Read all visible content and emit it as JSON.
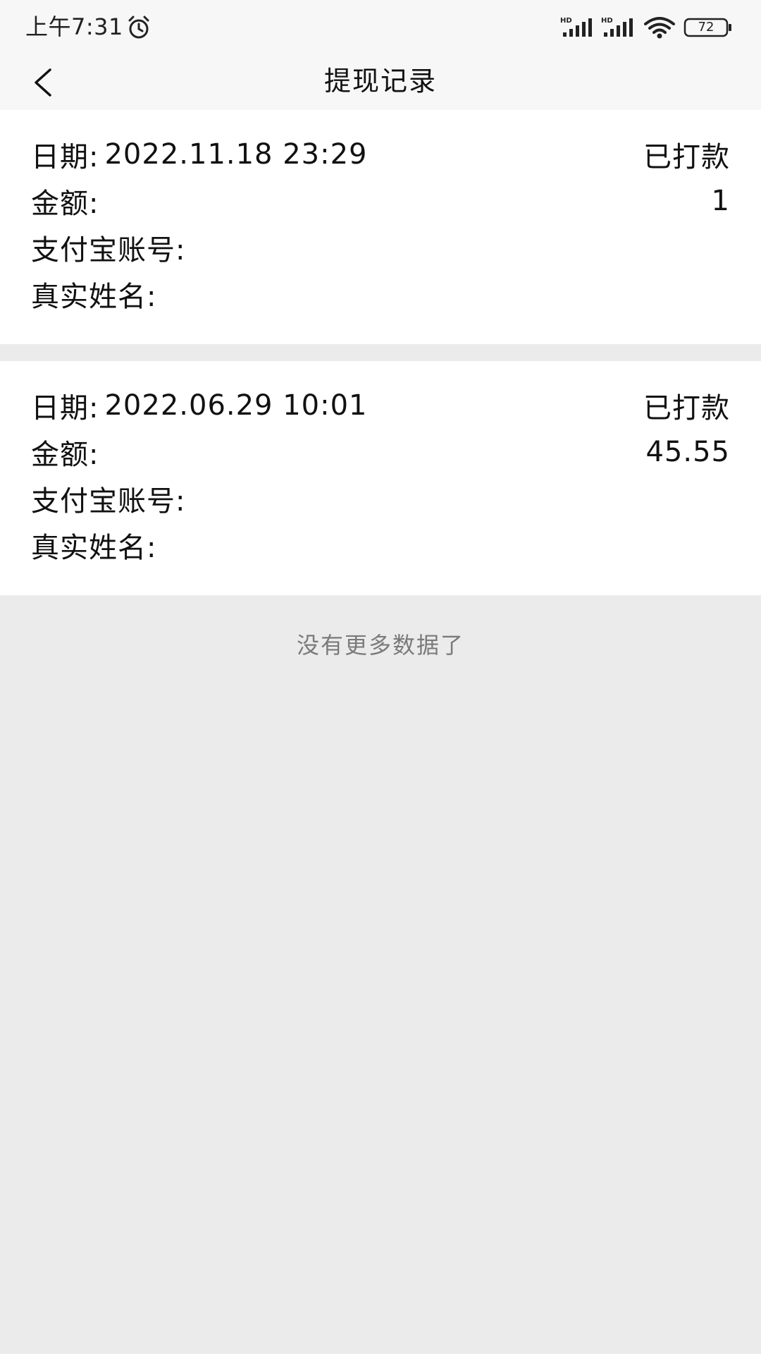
{
  "status_bar": {
    "time": "上午7:31",
    "battery": "72",
    "icons": [
      "alarm-icon",
      "signal-icon",
      "signal-icon",
      "wifi-icon",
      "battery-icon"
    ]
  },
  "app_bar": {
    "title": "提现记录",
    "back_icon": "chevron-left-icon"
  },
  "records": [
    {
      "date_label": "日期:",
      "date": "2022.11.18 23:29",
      "status": "已打款",
      "amount_label": "金额:",
      "amount": "1",
      "alipay_label": "支付宝账号:",
      "alipay": "",
      "name_label": "真实姓名:",
      "name": ""
    },
    {
      "date_label": "日期:",
      "date": "2022.06.29 10:01",
      "status": "已打款",
      "amount_label": "金额:",
      "amount": "45.55",
      "alipay_label": "支付宝账号:",
      "alipay": "",
      "name_label": "真实姓名:",
      "name": ""
    }
  ],
  "footer": {
    "no_more": "没有更多数据了"
  },
  "colors": {
    "background": "#ebebeb",
    "card": "#ffffff",
    "bar": "#f7f7f7",
    "text": "#111111",
    "muted": "#7a7a7a"
  }
}
